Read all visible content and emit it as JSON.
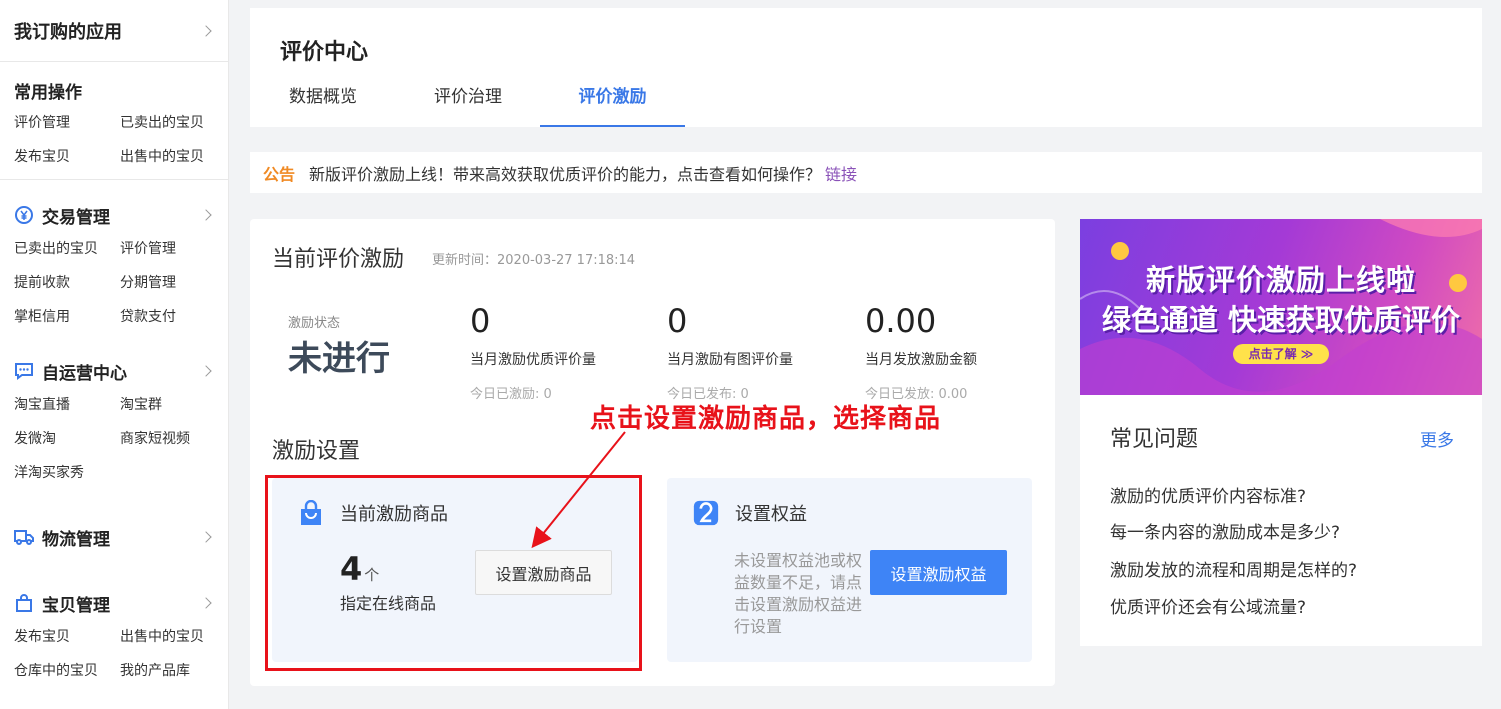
{
  "sidebar": {
    "top": "我订购的应用",
    "common": {
      "title": "常用操作",
      "items": [
        "评价管理",
        "已卖出的宝贝",
        "发布宝贝",
        "出售中的宝贝"
      ]
    },
    "trade": {
      "title": "交易管理",
      "items": [
        "已卖出的宝贝",
        "评价管理",
        "提前收款",
        "分期管理",
        "掌柜信用",
        "贷款支付"
      ]
    },
    "self": {
      "title": "自运营中心",
      "items": [
        "淘宝直播",
        "淘宝群",
        "发微淘",
        "商家短视频",
        "洋淘买家秀"
      ]
    },
    "logistics": {
      "title": "物流管理"
    },
    "goods": {
      "title": "宝贝管理",
      "items": [
        "发布宝贝",
        "出售中的宝贝",
        "仓库中的宝贝",
        "我的产品库"
      ]
    }
  },
  "header": {
    "title": "评价中心",
    "tabs": [
      {
        "label": "数据概览",
        "active": false
      },
      {
        "label": "评价治理",
        "active": false
      },
      {
        "label": "评价激励",
        "active": true
      }
    ]
  },
  "notice": {
    "tag": "公告",
    "message": "新版评价激励上线！带来高效获取优质评价的能力，点击查看如何操作？",
    "link": "链接"
  },
  "incentive": {
    "title": "当前评价激励",
    "update_time": "更新时间：2020-03-27 17:18:14",
    "status_label": "激励状态",
    "status_value": "未进行",
    "stats": [
      {
        "value": "0",
        "label": "当月激励优质评价量",
        "sub": "今日已激励: 0"
      },
      {
        "value": "0",
        "label": "当月激励有图评价量",
        "sub": "今日已发布: 0"
      },
      {
        "value": "0.00",
        "label": "当月发放激励金额",
        "sub": "今日已发放: 0.00"
      }
    ],
    "settings_title": "激励设置",
    "goods_box": {
      "title": "当前激励商品",
      "count": "4",
      "unit": "个",
      "desc": "指定在线商品",
      "button": "设置激励商品"
    },
    "rights_box": {
      "title": "设置权益",
      "desc": "未设置权益池或权益数量不足，请点击设置激励权益进行设置",
      "button": "设置激励权益"
    }
  },
  "annotation": "点击设置激励商品，选择商品",
  "banner": {
    "line1": "新版评价激励上线啦",
    "line2": "绿色通道 快速获取优质评价",
    "button": "点击了解 ≫"
  },
  "faq": {
    "title": "常见问题",
    "more": "更多",
    "items": [
      "激励的优质评价内容标准?",
      "每一条内容的激励成本是多少?",
      "激励发放的流程和周期是怎样的?",
      "优质评价还会有公域流量?"
    ]
  },
  "colors": {
    "accent": "#3a78e7",
    "primary_button": "#3e84f6",
    "annotation": "#e8121a",
    "notice_tag": "#f08a24"
  }
}
